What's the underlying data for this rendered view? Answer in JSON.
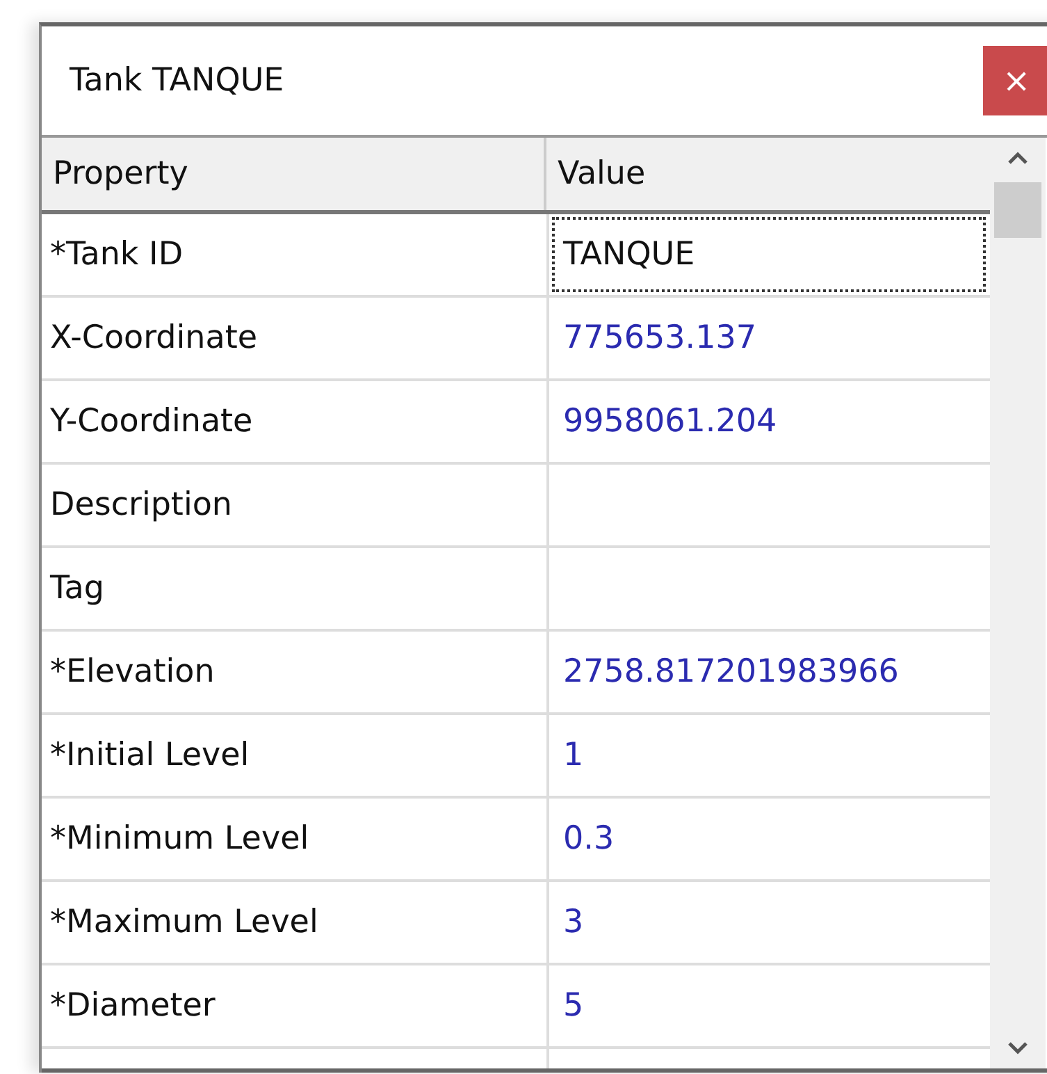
{
  "window": {
    "title": "Tank TANQUE",
    "close_button": "×"
  },
  "table": {
    "columns": [
      "Property",
      "Value"
    ],
    "rows": [
      {
        "property": "*Tank ID",
        "value": "TANQUE",
        "selected": true
      },
      {
        "property": "X-Coordinate",
        "value": "775653.137",
        "selected": false
      },
      {
        "property": "Y-Coordinate",
        "value": "9958061.204",
        "selected": false
      },
      {
        "property": "Description",
        "selected": false
      },
      {
        "property": "Tag",
        "selected": false
      },
      {
        "property": "*Elevation",
        "value": "2758.817201983966",
        "selected": false
      },
      {
        "property": "*Initial Level",
        "value": "1",
        "selected": false
      },
      {
        "property": "*Minimum Level",
        "value": "0.3",
        "selected": false
      },
      {
        "property": "*Maximum Level",
        "value": "3",
        "selected": false
      },
      {
        "property": "*Diameter",
        "value": "5",
        "selected": false
      }
    ]
  }
}
